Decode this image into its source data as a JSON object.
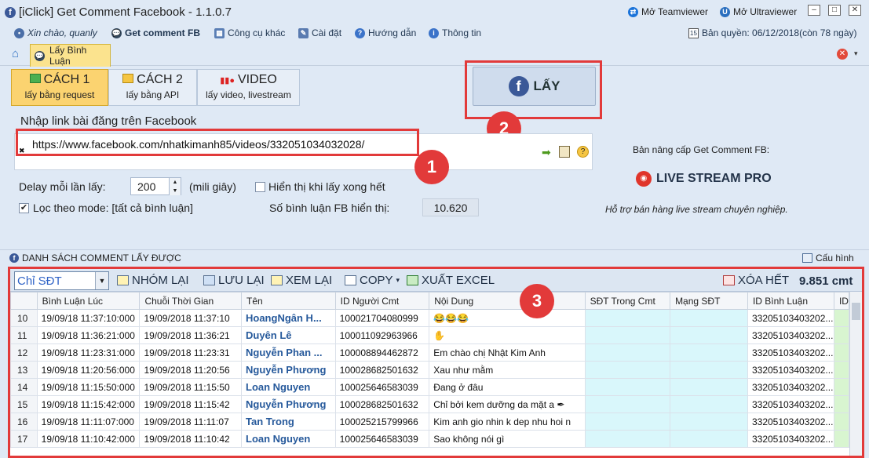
{
  "window": {
    "title": "[iClick] Get Comment Facebook - 1.1.0.7",
    "teamviewer_label": "Mở Teamviewer",
    "ultraviewer_label": "Mở Ultraviewer"
  },
  "menu": {
    "greeting": "Xin chào, quanly",
    "items": [
      "Get comment FB",
      "Công cụ khác",
      "Cài đặt",
      "Hướng dẫn",
      "Thông tin"
    ],
    "license": "Bản quyền: 06/12/2018(còn 78 ngày)"
  },
  "tabs": {
    "active_label": "Lấy Bình Luận"
  },
  "methods": [
    {
      "title": "CÁCH 1",
      "subtitle": "lấy bằng request"
    },
    {
      "title": "CÁCH 2",
      "subtitle": "lấy bằng API"
    },
    {
      "title": "VIDEO",
      "subtitle": "lấy video, livestream"
    }
  ],
  "get_button": {
    "label": "LẤY"
  },
  "form": {
    "url_label": "Nhập link bài đăng trên Facebook",
    "url_value": "https://www.facebook.com/nhatkimanh85/videos/332051034032028/",
    "delay_label": "Delay mỗi lần lấy:",
    "delay_value": "200",
    "delay_unit": "(mili giây)",
    "show_done_label": "Hiển thị khi lấy xong hết",
    "filter_mode_label": "Lọc theo mode: [tất cả bình luận]",
    "fb_count_label": "Số bình luận FB hiển thị:",
    "fb_count_value": "10.620"
  },
  "promo": {
    "upgrade_text": "Bản nâng cấp Get Comment FB:",
    "product": "LIVE STREAM PRO",
    "tagline": "Hỗ trợ bán hàng live stream chuyên nghiệp."
  },
  "badges": [
    "1",
    "2",
    "3"
  ],
  "list": {
    "title": "DANH SÁCH COMMENT LẤY ĐƯỢC",
    "config_label": "Cấu hình",
    "filter_value": "Chỉ SĐT",
    "toolbar": [
      "NHÓM LẠI",
      "LƯU LẠI",
      "XEM LẠI",
      "COPY",
      "XUẤT EXCEL"
    ],
    "clear_label": "XÓA HẾT",
    "count": "9.851 cmt",
    "columns": [
      "Bình Luận Lúc",
      "Chuỗi Thời Gian",
      "Tên",
      "ID Người Cmt",
      "Nội Dung",
      "SĐT Trong Cmt",
      "Mạng SĐT",
      "ID Bình Luận",
      "ID"
    ],
    "rows": [
      [
        "10",
        "19/09/18 11:37:10:000",
        "19/09/2018 11:37:10",
        "HoangNgân H...",
        "100021704080999",
        "😂😂😂",
        "",
        "",
        "33205103403202..."
      ],
      [
        "11",
        "19/09/18 11:36:21:000",
        "19/09/2018 11:36:21",
        "Duyên Lê",
        "100011092963966",
        "✋",
        "",
        "",
        "33205103403202..."
      ],
      [
        "12",
        "19/09/18 11:23:31:000",
        "19/09/2018 11:23:31",
        "Nguyễn Phan ...",
        "100008894462872",
        "Em chào chị Nhật Kim Anh",
        "",
        "",
        "33205103403202..."
      ],
      [
        "13",
        "19/09/18 11:20:56:000",
        "19/09/2018 11:20:56",
        "Nguyễn Phương",
        "100028682501632",
        "Xau như mằm",
        "",
        "",
        "33205103403202..."
      ],
      [
        "14",
        "19/09/18 11:15:50:000",
        "19/09/2018 11:15:50",
        "Loan Nguyen",
        "100025646583039",
        "Đang ở đâu",
        "",
        "",
        "33205103403202..."
      ],
      [
        "15",
        "19/09/18 11:15:42:000",
        "19/09/2018 11:15:42",
        "Nguyễn Phương",
        "100028682501632",
        "Chỉ bởi kem dưỡng da mặt a ✒",
        "",
        "",
        "33205103403202..."
      ],
      [
        "16",
        "19/09/18 11:11:07:000",
        "19/09/2018 11:11:07",
        "Tan Trong",
        "100025215799966",
        "Kim anh gio nhin k dep nhu hoi n",
        "",
        "",
        "33205103403202..."
      ],
      [
        "17",
        "19/09/18 11:10:42:000",
        "19/09/2018 11:10:42",
        "Loan Nguyen",
        "100025646583039",
        "Sao không nói gì",
        "",
        "",
        "33205103403202..."
      ]
    ]
  }
}
